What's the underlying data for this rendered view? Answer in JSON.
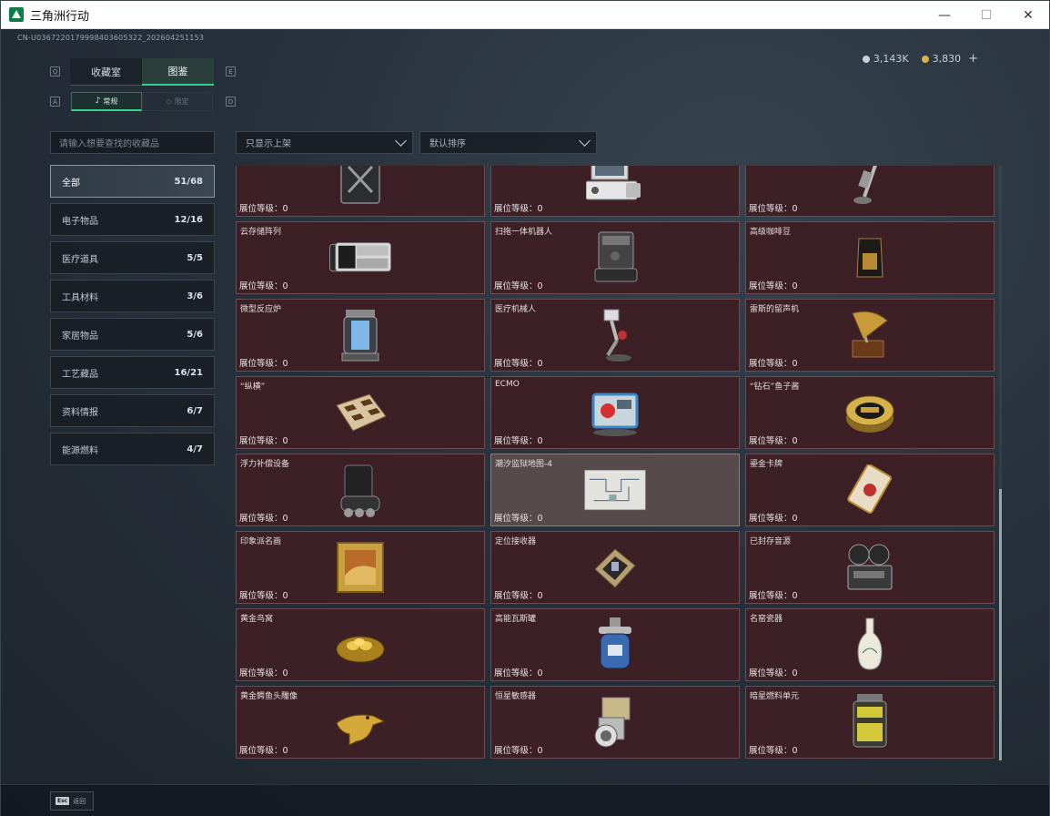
{
  "window": {
    "title": "三角洲行动",
    "minimize": "—",
    "maximize": "☐",
    "close": "✕"
  },
  "header": {
    "uid": "CN-U0367220179998403605322_202604251153",
    "currency_silver": "3,143K",
    "currency_gold": "3,830",
    "currency_plus": "+",
    "key_q": "Q",
    "key_e": "E",
    "key_a": "A",
    "key_d": "D"
  },
  "tabs": {
    "main": [
      "收藏室",
      "图鉴"
    ],
    "sub": [
      "常规",
      "限定"
    ]
  },
  "filters": {
    "search_placeholder": "请输入想要查找的收藏品",
    "shelf_filter": "只显示上架",
    "sort": "默认排序"
  },
  "categories": [
    {
      "label": "全部",
      "count": "51/68"
    },
    {
      "label": "电子物品",
      "count": "12/16"
    },
    {
      "label": "医疗道具",
      "count": "5/5"
    },
    {
      "label": "工具材料",
      "count": "3/6"
    },
    {
      "label": "家居物品",
      "count": "5/6"
    },
    {
      "label": "工艺藏品",
      "count": "16/21"
    },
    {
      "label": "资料情报",
      "count": "6/7"
    },
    {
      "label": "能源燃料",
      "count": "4/7"
    }
  ],
  "level_label": "展位等级：0",
  "items": [
    {
      "name": "",
      "icon": "server-case-icon"
    },
    {
      "name": "",
      "icon": "monitor-device-icon"
    },
    {
      "name": "",
      "icon": "vacuum-icon"
    },
    {
      "name": "云存储阵列",
      "icon": "storage-array-icon"
    },
    {
      "name": "扫拖一体机器人",
      "icon": "robot-vacuum-icon"
    },
    {
      "name": "高级咖啡豆",
      "icon": "coffee-bag-icon"
    },
    {
      "name": "微型反应炉",
      "icon": "reactor-icon"
    },
    {
      "name": "医疗机械人",
      "icon": "medical-robot-icon"
    },
    {
      "name": "雷斯的留声机",
      "icon": "gramophone-icon"
    },
    {
      "name": "“纵横”",
      "icon": "chessboard-icon"
    },
    {
      "name": "ECMO",
      "icon": "ecmo-icon"
    },
    {
      "name": "“钻石”鱼子酱",
      "icon": "caviar-tin-icon"
    },
    {
      "name": "浮力补偿设备",
      "icon": "bcd-vest-icon"
    },
    {
      "name": "潮汐监狱地图-4",
      "icon": "map-icon"
    },
    {
      "name": "鎏金卡牌",
      "icon": "gold-card-icon"
    },
    {
      "name": "印象派名画",
      "icon": "painting-icon"
    },
    {
      "name": "定位接收器",
      "icon": "receiver-icon"
    },
    {
      "name": "已封存音源",
      "icon": "reel-recorder-icon"
    },
    {
      "name": "黄金鸟窝",
      "icon": "golden-nest-icon"
    },
    {
      "name": "高能瓦斯罐",
      "icon": "gas-canister-icon"
    },
    {
      "name": "名窑瓷器",
      "icon": "porcelain-vase-icon"
    },
    {
      "name": "黄金鳄鱼头雕像",
      "icon": "croc-statue-icon"
    },
    {
      "name": "恒星敏感器",
      "icon": "star-sensor-icon"
    },
    {
      "name": "暗星燃料单元",
      "icon": "fuel-cell-icon"
    }
  ],
  "footer": {
    "esc_key": "Esc",
    "back_label": "返回"
  },
  "colors": {
    "accent_green": "#33d38a",
    "card_bg": "#3d2026",
    "card_border": "#6e4a52"
  }
}
